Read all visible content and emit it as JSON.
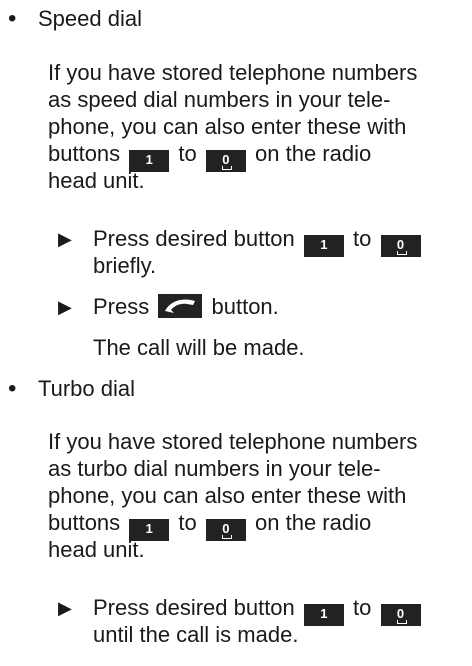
{
  "sections": [
    {
      "title": "Speed dial",
      "para_lines": [
        "If you have stored telephone numbers",
        "as speed dial numbers in your tele-",
        "phone, you can also enter these with"
      ],
      "buttons_word": "buttons",
      "to_word": "to",
      "radio_tail": "on the radio",
      "head_unit": "head unit.",
      "step1_pre": "Press desired button",
      "step1_to": "to",
      "step1_tail": "briefly.",
      "step2_pre": "Press",
      "step2_post": "button.",
      "result": "The call will be made."
    },
    {
      "title": "Turbo dial",
      "para_lines": [
        "If you have stored telephone numbers",
        "as turbo dial numbers in your tele-",
        "phone, you can also enter these with"
      ],
      "buttons_word": "buttons",
      "to_word": "to",
      "radio_tail": "on the radio",
      "head_unit": "head unit.",
      "step1_pre": "Press desired button",
      "step1_to": "to",
      "step1_tail": "until the call is made."
    }
  ],
  "keys": {
    "one": "1",
    "zero": "0"
  },
  "icons": {
    "bullet": "•",
    "step_arrow": "▶",
    "phone_key": "phone-handset-icon"
  },
  "colors": {
    "key_bg": "#222222",
    "key_fg": "#ffffff",
    "text": "#1a1a1a"
  }
}
